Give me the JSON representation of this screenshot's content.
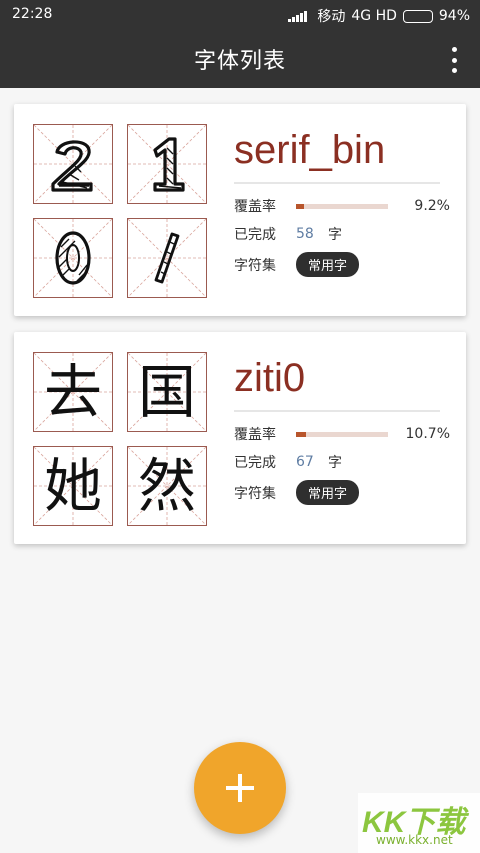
{
  "status": {
    "time": "22:28",
    "carrier": "移动",
    "network": "4G HD",
    "battery": "94%",
    "battery_level": 0.94
  },
  "appbar": {
    "title": "字体列表",
    "menu_icon": "more-vert-icon"
  },
  "labels": {
    "coverage": "覆盖率",
    "completed": "已完成",
    "charset": "字符集",
    "unit": "字"
  },
  "fonts": [
    {
      "name": "serif_bin",
      "preview": [
        "2",
        "1",
        "0",
        "/"
      ],
      "coverage_pct": "9.2%",
      "coverage_value": 0.092,
      "completed": "58",
      "charset": "常用字"
    },
    {
      "name": "ziti0",
      "preview": [
        "去",
        "国",
        "她",
        "然"
      ],
      "coverage_pct": "10.7%",
      "coverage_value": 0.107,
      "completed": "67",
      "charset": "常用字"
    }
  ],
  "fab": {
    "icon": "plus-icon"
  },
  "watermark": {
    "logo": "KK下载",
    "url": "www.kkx.net"
  },
  "colors": {
    "appbar": "#333333",
    "font_name": "#8b2f22",
    "coverage_fill": "#b8552c",
    "fab": "#f0a52b",
    "grid_border": "#9b5a50"
  }
}
